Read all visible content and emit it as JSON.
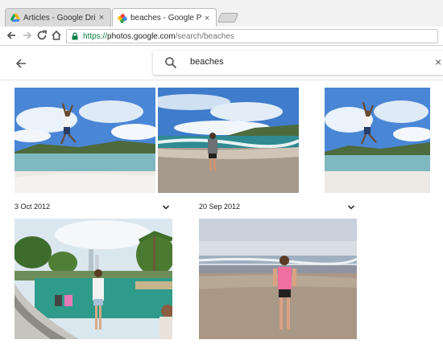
{
  "browser": {
    "tabs": [
      {
        "title": "Articles - Google Drive",
        "close": "×",
        "active": false
      },
      {
        "title": "beaches - Google Photos",
        "close": "×",
        "active": true
      }
    ],
    "url": {
      "scheme": "https://",
      "host": "photos.google.com",
      "path": "/search/beaches"
    }
  },
  "search": {
    "query": "beaches",
    "clear": "×"
  },
  "groups": [
    {
      "date": "3 Oct 2012"
    },
    {
      "date": "20 Sep 2012"
    }
  ],
  "icons": {
    "back": "arrow-left-icon",
    "search": "search-icon",
    "chevron": "chevron-down-icon"
  },
  "colors": {
    "secure": "#0b8043",
    "drive_yellow": "#f4b400",
    "drive_green": "#0f9d58",
    "drive_blue": "#4285f4"
  }
}
